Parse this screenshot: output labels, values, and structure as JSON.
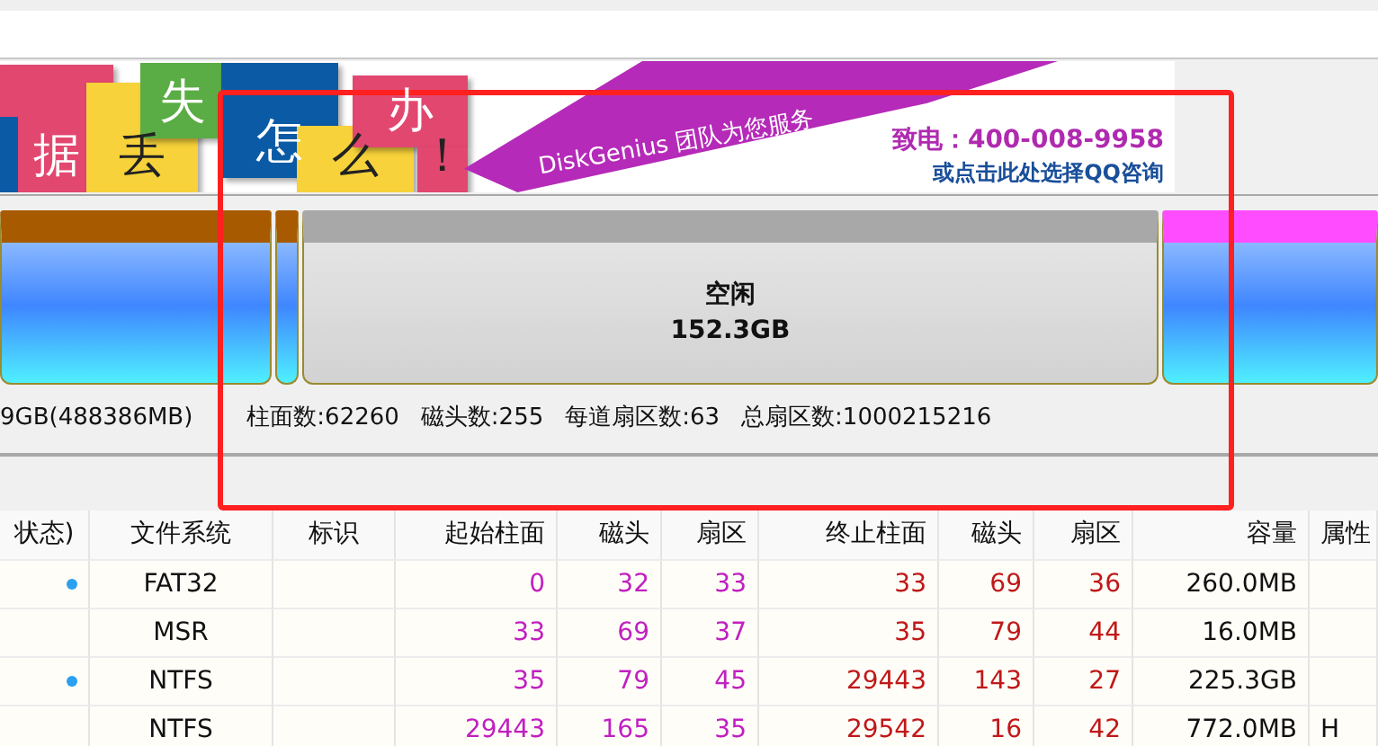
{
  "banner": {
    "tiles": [
      {
        "text": "据",
        "color": "#e2476f"
      },
      {
        "text": "丢",
        "color": "#f7d23a"
      },
      {
        "text": "失",
        "color": "#5aac44"
      },
      {
        "text": "怎",
        "color": "#0b5aa5"
      },
      {
        "text": "么",
        "color": "#f7d23a"
      },
      {
        "text": "办",
        "color": "#e2476f"
      },
      {
        "text": "！",
        "color": "#e2476f"
      }
    ],
    "tagline": "DiskGenius 团队为您服务",
    "phone": "致电：400-008-9958",
    "qq_link": "或点击此处选择QQ咨询"
  },
  "disk_map": {
    "segments": [
      {
        "kind": "partition",
        "color": "#a85a00"
      },
      {
        "kind": "partition",
        "color": "#a85a00"
      },
      {
        "kind": "free",
        "label": "空闲",
        "size": "152.3GB"
      },
      {
        "kind": "partition",
        "color": "#ff4cff"
      }
    ]
  },
  "disk_info": [
    "9GB(488386MB)",
    "柱面数:62260",
    "磁头数:255",
    "每道扇区数:63",
    "总扇区数:1000215216"
  ],
  "table": {
    "columns": [
      "状态)",
      "文件系统",
      "标识",
      "起始柱面",
      "磁头",
      "扇区",
      "终止柱面",
      "磁头",
      "扇区",
      "容量",
      "属性"
    ],
    "rows": [
      {
        "status_icon": true,
        "cells": [
          "",
          "FAT32",
          "",
          "0",
          "32",
          "33",
          "33",
          "69",
          "36",
          "260.0MB",
          ""
        ]
      },
      {
        "status_icon": false,
        "cells": [
          "",
          "MSR",
          "",
          "33",
          "69",
          "37",
          "35",
          "79",
          "44",
          "16.0MB",
          ""
        ]
      },
      {
        "status_icon": true,
        "cells": [
          "",
          "NTFS",
          "",
          "35",
          "79",
          "45",
          "29443",
          "143",
          "27",
          "225.3GB",
          ""
        ]
      },
      {
        "status_icon": false,
        "cells": [
          "",
          "NTFS",
          "",
          "29443",
          "165",
          "35",
          "29542",
          "16",
          "42",
          "772.0MB",
          "H"
        ]
      }
    ]
  }
}
